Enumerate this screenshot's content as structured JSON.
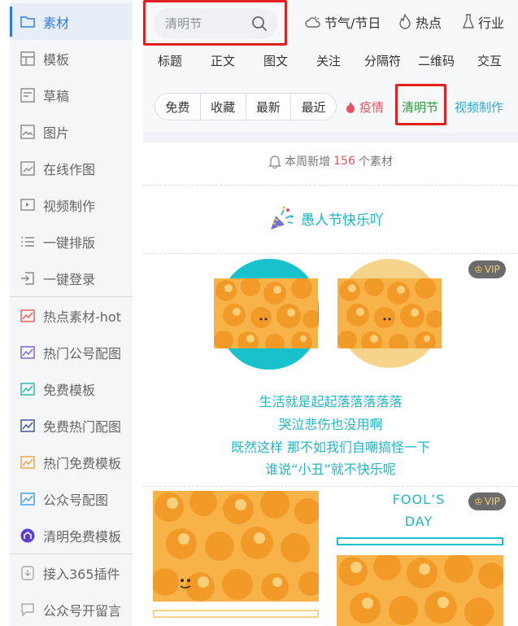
{
  "sidebar": {
    "items": [
      {
        "label": "素材",
        "icon": "folder-icon",
        "active": true
      },
      {
        "label": "模板",
        "icon": "template-icon"
      },
      {
        "label": "草稿",
        "icon": "draft-icon"
      },
      {
        "label": "图片",
        "icon": "image-icon"
      },
      {
        "label": "在线作图",
        "icon": "edit-image-icon"
      },
      {
        "label": "视频制作",
        "icon": "video-icon"
      },
      {
        "label": "一键排版",
        "icon": "list-icon"
      },
      {
        "label": "一键登录",
        "icon": "login-icon"
      },
      {
        "label": "热点素材-hot",
        "icon": "chart-icon"
      },
      {
        "label": "热门公号配图",
        "icon": "chart-icon"
      },
      {
        "label": "免费模板",
        "icon": "chart-icon"
      },
      {
        "label": "免费热门配图",
        "icon": "chart-icon"
      },
      {
        "label": "热门免费模板",
        "icon": "chart-icon"
      },
      {
        "label": "公众号配图",
        "icon": "chart-icon"
      },
      {
        "label": "清明免费模板",
        "icon": "badge-icon"
      },
      {
        "label": "接入365插件",
        "icon": "plugin-icon"
      },
      {
        "label": "公众号开留言",
        "icon": "comment-icon"
      }
    ]
  },
  "search": {
    "placeholder": "清明节"
  },
  "categories": [
    {
      "label": "节气/节日",
      "icon": "weather-icon"
    },
    {
      "label": "热点",
      "icon": "fire-icon"
    },
    {
      "label": "行业",
      "icon": "flask-icon"
    }
  ],
  "tabs": [
    "标题",
    "正文",
    "图文",
    "关注",
    "分隔符",
    "二维码",
    "交互"
  ],
  "filters": [
    "免费",
    "收藏",
    "最新",
    "最近"
  ],
  "tags": {
    "hot": "疫情",
    "festival": "清明节",
    "video": "视频制作"
  },
  "weekly": {
    "prefix": "本周新增",
    "count": "156",
    "suffix": "个素材"
  },
  "section_title": "愚人节快乐吖",
  "vip_label": "VIP",
  "poem_lines": [
    "生活就是起起落落落落落",
    "哭泣悲伤也没用啊",
    "既然这样 那不如我们自嘲搞怪一下",
    "谁说“小丑”就不快乐呢"
  ],
  "fool_day": {
    "line1": "FOOL’S",
    "line2": "DAY"
  },
  "colors": {
    "accent": "#2f7be6",
    "teal": "#1ab5c8",
    "red": "#e02020",
    "hot": "#e8505b",
    "green": "#2a9d3a",
    "vip_bg": "#6b6b6b",
    "vip_text": "#f3d36b"
  }
}
